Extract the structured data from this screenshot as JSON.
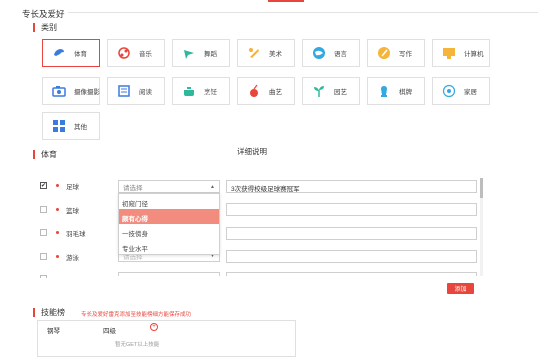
{
  "section": {
    "title": "专长及爱好"
  },
  "categories": {
    "header": "类别",
    "items": [
      {
        "label": "体育",
        "icon": "sports-icon",
        "selected": true
      },
      {
        "label": "音乐",
        "icon": "music-icon",
        "selected": false
      },
      {
        "label": "舞蹈",
        "icon": "dance-icon",
        "selected": false
      },
      {
        "label": "美术",
        "icon": "art-icon",
        "selected": false
      },
      {
        "label": "语言",
        "icon": "language-icon",
        "selected": false
      },
      {
        "label": "写作",
        "icon": "writing-icon",
        "selected": false
      },
      {
        "label": "计算机",
        "icon": "computer-icon",
        "selected": false
      },
      {
        "label": "摄像摄影",
        "icon": "camera-icon",
        "selected": false
      },
      {
        "label": "阅读",
        "icon": "reading-icon",
        "selected": false
      },
      {
        "label": "烹饪",
        "icon": "cooking-icon",
        "selected": false
      },
      {
        "label": "曲艺",
        "icon": "opera-icon",
        "selected": false
      },
      {
        "label": "园艺",
        "icon": "gardening-icon",
        "selected": false
      },
      {
        "label": "棋牌",
        "icon": "chess-icon",
        "selected": false
      },
      {
        "label": "家居",
        "icon": "home-icon",
        "selected": false
      },
      {
        "label": "其他",
        "icon": "other-icon",
        "selected": false
      }
    ]
  },
  "sports": {
    "header": "体育",
    "detail_header": "详细说明",
    "rows": [
      {
        "name": "足球",
        "checked": true,
        "level": "请选择",
        "detail": "3次获得校级足球赛冠军"
      },
      {
        "name": "篮球",
        "checked": false,
        "level": "",
        "detail": ""
      },
      {
        "name": "羽毛球",
        "checked": false,
        "level": "",
        "detail": ""
      },
      {
        "name": "游泳",
        "checked": false,
        "level": "请选择",
        "detail": ""
      }
    ],
    "dropdown_options": [
      "初窥门径",
      "颇有心得",
      "一技傍身",
      "专业水平"
    ],
    "dropdown_highlight": 1,
    "add_label": "添加"
  },
  "skills": {
    "header": "技能榜",
    "note": "专长及爱好雷克添加至技能榜细方能保存成功",
    "row": {
      "name": "钢琴",
      "level": "四级"
    },
    "empty_hint": "暂无GET以上技能"
  },
  "colors": {
    "accent": "#e8453c",
    "highlight": "#f28c7f"
  }
}
